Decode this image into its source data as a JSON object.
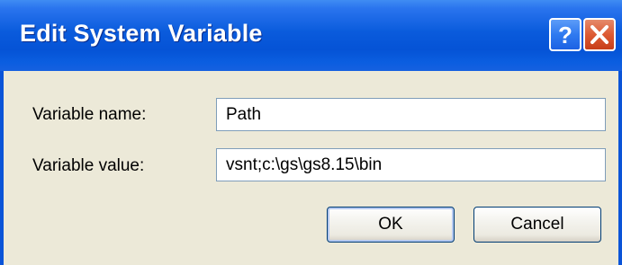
{
  "window": {
    "title": "Edit System Variable"
  },
  "title_buttons": {
    "help_icon": "help-icon",
    "close_icon": "close-icon"
  },
  "form": {
    "name_label": "Variable name:",
    "name_value": "Path",
    "value_label": "Variable value:",
    "value_value": "vsnt;c:\\gs\\gs8.15\\bin"
  },
  "buttons": {
    "ok_label": "OK",
    "cancel_label": "Cancel"
  },
  "colors": {
    "titlebar": "#0553d6",
    "dialog_face": "#ece9d8",
    "close_button": "#dd5a33",
    "help_button": "#2f7af0"
  }
}
